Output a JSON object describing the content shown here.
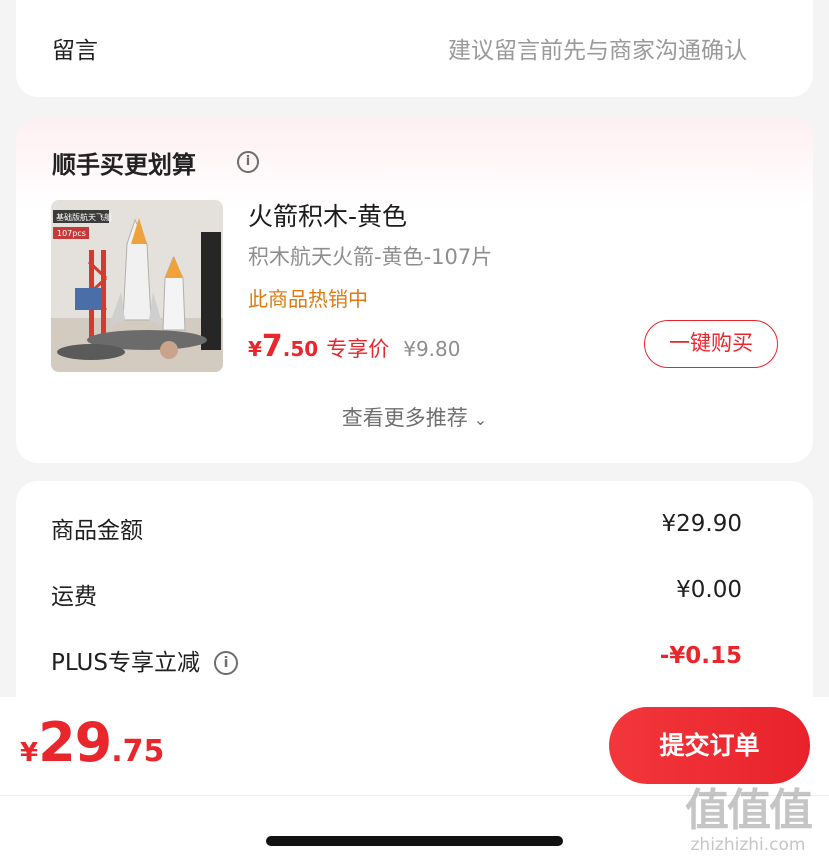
{
  "note": {
    "label": "留言",
    "placeholder": "建议留言前先与商家沟通确认"
  },
  "recommend": {
    "title": "顺手买更划算",
    "more_label": "查看更多推荐",
    "product": {
      "name": "火箭积木-黄色",
      "spec": "积木航天火箭-黄色-107片",
      "hot_label": "此商品热销中",
      "price_currency": "¥",
      "price_int": "7",
      "price_dec": ".50",
      "price_tag": "专享价",
      "original_price": "¥9.80",
      "buy_button": "一键购买",
      "image_badge": "基础版航天飞船",
      "image_pcs": "107pcs"
    }
  },
  "summary": {
    "rows": [
      {
        "label": "商品金额",
        "value": "¥29.90"
      },
      {
        "label": "运费",
        "value": "¥0.00"
      },
      {
        "label": "PLUS专享立减",
        "value": "-¥0.15"
      }
    ]
  },
  "bottom": {
    "currency": "¥",
    "total_int": "29",
    "total_dec": ".75",
    "submit_label": "提交订单"
  },
  "watermark": {
    "logo": "值值值",
    "site": "zhizhizhi.com"
  },
  "colors": {
    "accent": "#e8262c",
    "hot": "#e07a10",
    "muted": "#8e8e8e"
  },
  "icons": {
    "info": "info-circle-icon",
    "chevron": "chevron-down-icon"
  }
}
